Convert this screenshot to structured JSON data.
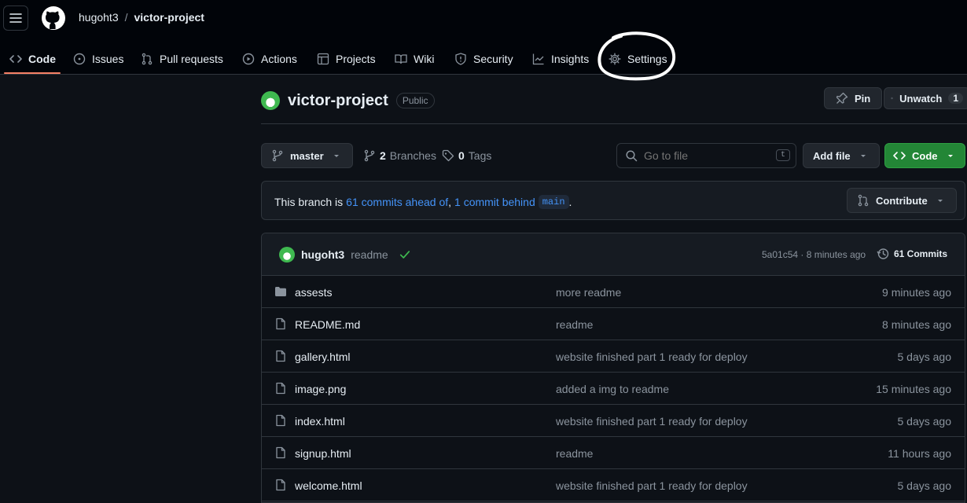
{
  "header": {
    "owner": "hugoht3",
    "separator": "/",
    "repo": "victor-project"
  },
  "tabs": [
    {
      "label": "Code",
      "icon": "code-icon"
    },
    {
      "label": "Issues",
      "icon": "issue-icon"
    },
    {
      "label": "Pull requests",
      "icon": "pull-request-icon"
    },
    {
      "label": "Actions",
      "icon": "play-icon"
    },
    {
      "label": "Projects",
      "icon": "table-icon"
    },
    {
      "label": "Wiki",
      "icon": "book-icon"
    },
    {
      "label": "Security",
      "icon": "shield-icon"
    },
    {
      "label": "Insights",
      "icon": "graph-icon"
    },
    {
      "label": "Settings",
      "icon": "gear-icon"
    }
  ],
  "repo": {
    "name": "victor-project",
    "visibility": "Public",
    "pin_label": "Pin",
    "watch_label": "Unwatch",
    "watch_count": "1"
  },
  "toolbar": {
    "branch": "master",
    "branches_count": "2",
    "branches_label": "Branches",
    "tags_count": "0",
    "tags_label": "Tags",
    "search_placeholder": "Go to file",
    "search_key": "t",
    "add_file_label": "Add file",
    "code_label": "Code"
  },
  "branch_info": {
    "prefix": "This branch is",
    "ahead": "61 commits ahead of",
    "comma": ",",
    "behind": "1 commit behind",
    "base": "main",
    "suffix": ".",
    "contribute_label": "Contribute"
  },
  "latest_commit": {
    "author": "hugoht3",
    "message": "readme",
    "hash_time": "5a01c54 · 8 minutes ago",
    "commits_label": "61 Commits"
  },
  "files": [
    {
      "type": "folder",
      "name": "assests",
      "message": "more readme",
      "time": "9 minutes ago"
    },
    {
      "type": "file",
      "name": "README.md",
      "message": "readme",
      "time": "8 minutes ago"
    },
    {
      "type": "file",
      "name": "gallery.html",
      "message": "website finished part 1 ready for deploy",
      "time": "5 days ago"
    },
    {
      "type": "file",
      "name": "image.png",
      "message": "added a img to readme",
      "time": "15 minutes ago"
    },
    {
      "type": "file",
      "name": "index.html",
      "message": "website finished part 1 ready for deploy",
      "time": "5 days ago"
    },
    {
      "type": "file",
      "name": "signup.html",
      "message": "readme",
      "time": "11 hours ago"
    },
    {
      "type": "file",
      "name": "welcome.html",
      "message": "website finished part 1 ready for deploy",
      "time": "5 days ago"
    }
  ],
  "colors": {
    "accent_underline": "#f78166",
    "link": "#4493f8",
    "primary_button": "#238636",
    "annotation_circle": "#ffffff"
  }
}
